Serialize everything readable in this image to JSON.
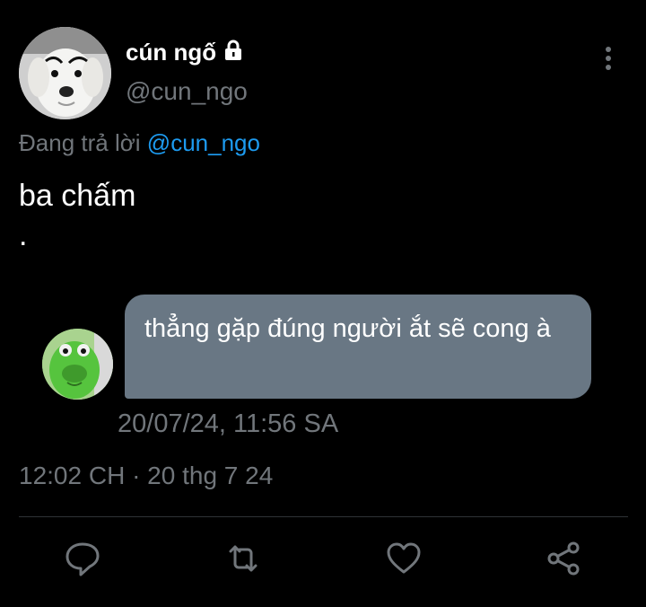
{
  "author": {
    "display_name": "cún ngố",
    "handle": "@cun_ngo"
  },
  "icons": {
    "lock": "lock-icon",
    "more": "more-vertical-icon",
    "reply": "reply-icon",
    "retweet": "retweet-icon",
    "like": "heart-icon",
    "share": "share-icon"
  },
  "reply": {
    "prefix": "Đang trả lời",
    "to_handle": "@cun_ngo"
  },
  "tweet": {
    "text": "ba chấm\n.",
    "timestamp": "12:02 CH · 20 thg 7 24"
  },
  "dm": {
    "message": "thẳng gặp đúng người ắt sẽ cong à",
    "timestamp": "20/07/24, 11:56 SA"
  },
  "colors": {
    "background": "#000000",
    "text": "#e7e9ea",
    "secondary": "#71767b",
    "link": "#1d9bf0",
    "bubble": "#697784",
    "divider": "#2f3336"
  }
}
